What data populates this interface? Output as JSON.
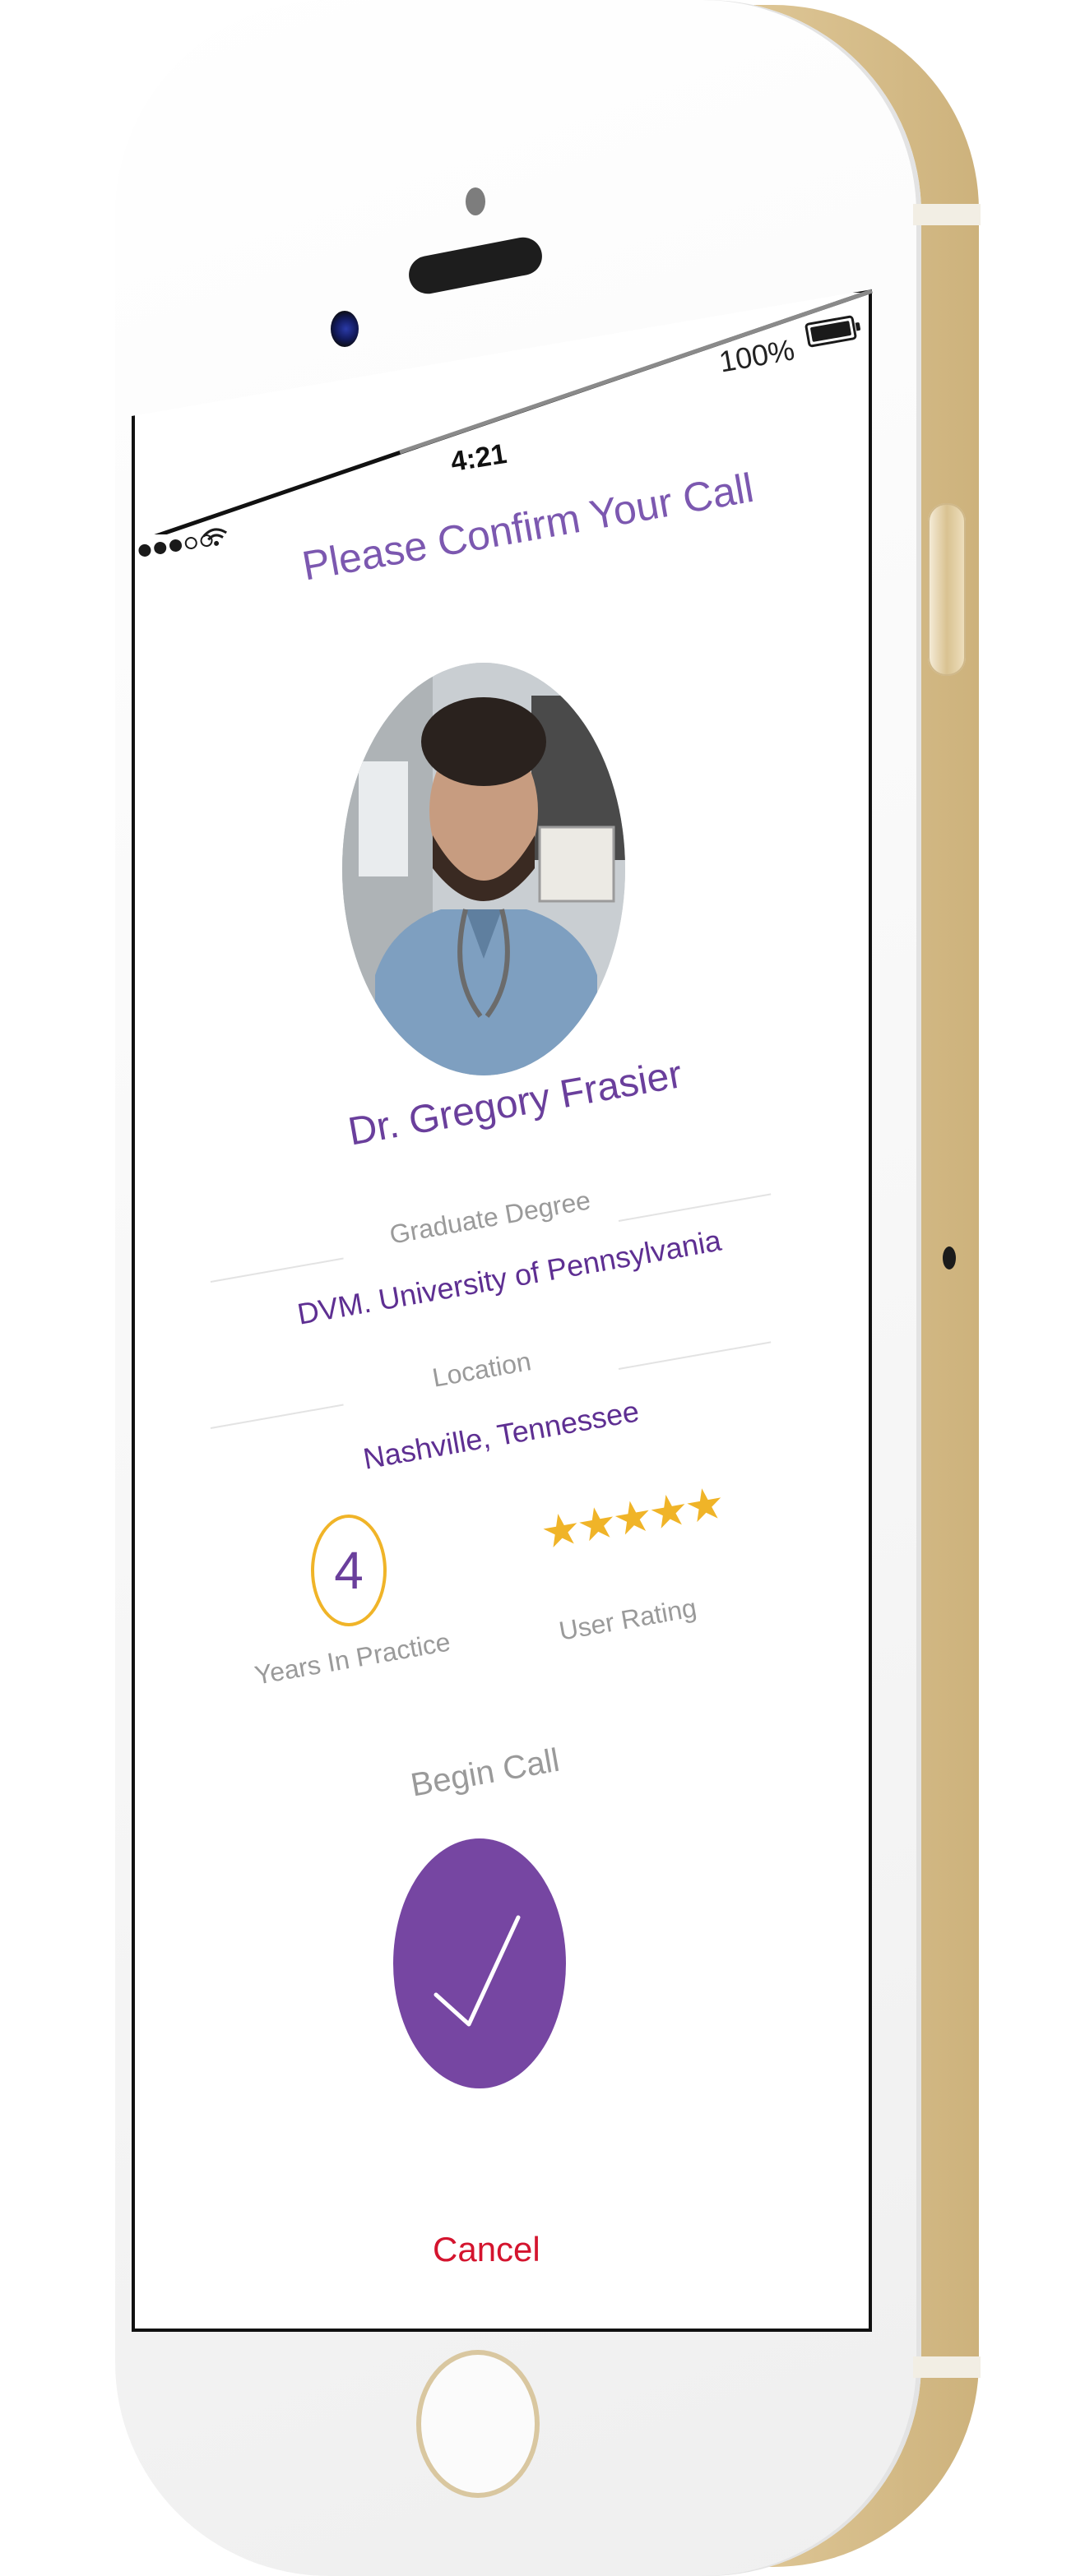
{
  "status_bar": {
    "time": "4:21",
    "battery_percent": "100%",
    "signal_dots_filled": 3,
    "signal_dots_total": 5,
    "wifi_icon": "wifi-icon",
    "battery_icon": "battery-icon"
  },
  "confirm_call": {
    "title": "Please Confirm Your Call",
    "doctor": {
      "name": "Dr. Gregory Frasier",
      "photo_icon": "doctor-photo"
    },
    "details": [
      {
        "label": "Graduate Degree",
        "value": "DVM. University of Pennsylvania"
      },
      {
        "label": "Location",
        "value": "Nashville, Tennessee"
      }
    ],
    "stats": {
      "years_value": "4",
      "years_label": "Years In Practice",
      "stars": "★★★★★",
      "rating_value": 5,
      "rating_max": 5,
      "rating_label": "User Rating"
    },
    "begin_call_label": "Begin Call",
    "begin_call_icon": "checkmark-icon",
    "cancel_label": "Cancel"
  },
  "colors": {
    "accent_purple": "#7646a2",
    "title_purple": "#7c58b0",
    "star_gold": "#f0b428",
    "cancel_red": "#d4142e",
    "phone_gold": "#e9d7b0"
  }
}
